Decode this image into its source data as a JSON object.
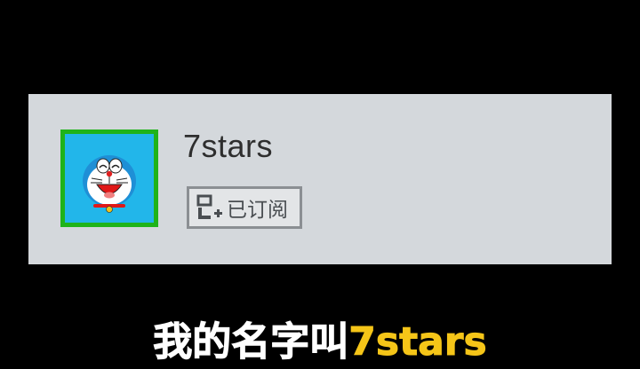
{
  "channel_card": {
    "username": "7stars",
    "avatar_icon": "doraemon-face-icon",
    "subscribe_button": {
      "icon": "subscribed-user-icon",
      "label": "已订阅"
    }
  },
  "caption": {
    "prefix": "我的名字叫",
    "highlight": "7stars"
  },
  "colors": {
    "background": "#000000",
    "card": "#d4d8dc",
    "avatar_border": "#1fb31a",
    "avatar_bg": "#22b6ea",
    "caption_text": "#ffffff",
    "caption_highlight": "#f5c518"
  }
}
